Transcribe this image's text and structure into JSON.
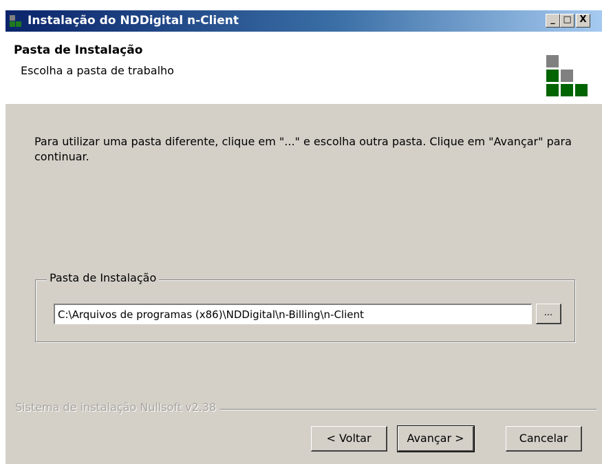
{
  "window": {
    "title": "Instalação do NDDigital n-Client",
    "controls": {
      "minimize": "_",
      "maximize": "□",
      "close": "X"
    }
  },
  "header": {
    "title": "Pasta de Instalação",
    "subtitle": "Escolha a pasta de trabalho"
  },
  "body": {
    "instructions": "Para utilizar uma pasta diferente, clique em \"...\" e escolha outra pasta. Clique em \"Avançar\" para continuar."
  },
  "install_folder": {
    "group_label": "Pasta de Instalação",
    "path_value": "C:\\Arquivos de programas (x86)\\NDDigital\\n-Billing\\n-Client",
    "browse_label": "..."
  },
  "footer": {
    "brand": "Sistema de instalação Nullsoft v2.38",
    "back_label": "< Voltar",
    "next_label": "Avançar >",
    "cancel_label": "Cancelar"
  },
  "colors": {
    "titlebar_start": "#0a246a",
    "titlebar_end": "#a6caf0",
    "logo_gray": "#808080",
    "logo_green": "#006400",
    "face": "#d4d0c8"
  }
}
